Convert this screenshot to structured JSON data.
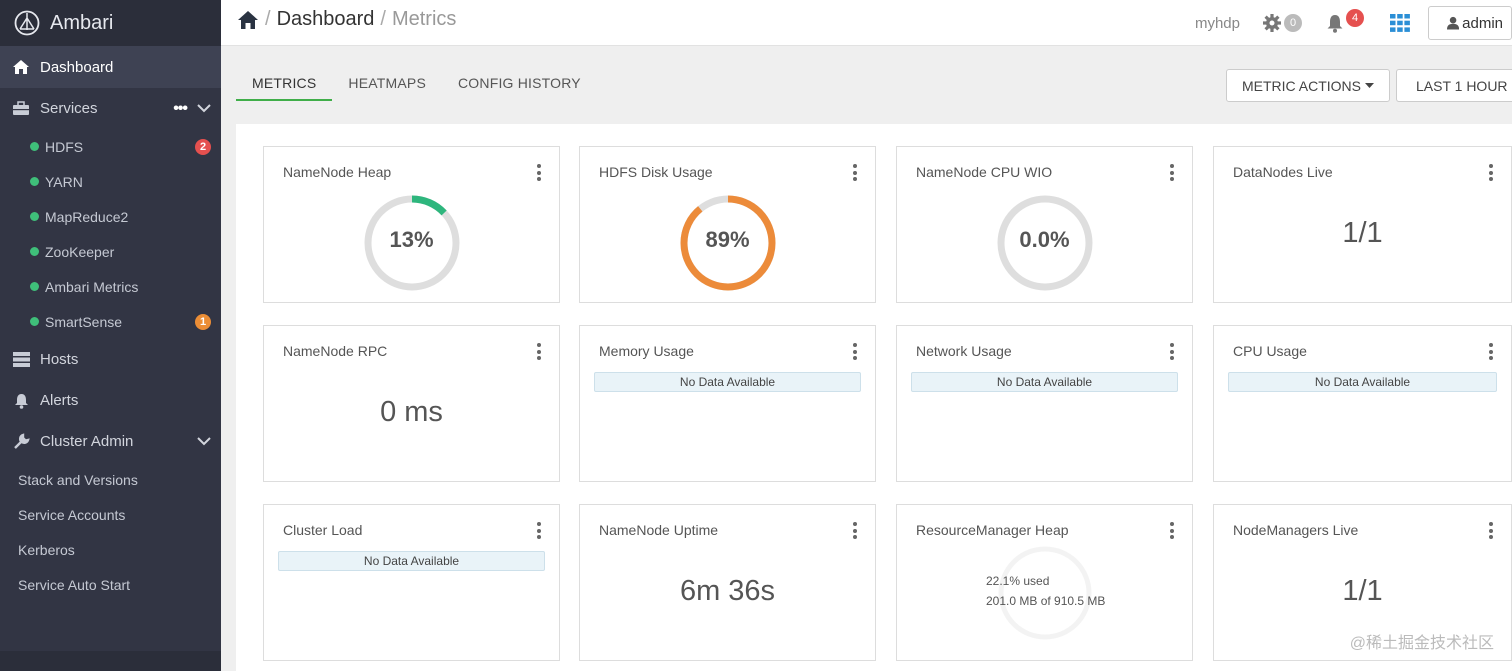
{
  "app": {
    "name": "Ambari"
  },
  "sidebar": {
    "dashboard": "Dashboard",
    "services": "Services",
    "service_items": [
      {
        "label": "HDFS",
        "badge": "2",
        "badge_color": "#e5504f"
      },
      {
        "label": "YARN"
      },
      {
        "label": "MapReduce2"
      },
      {
        "label": "ZooKeeper"
      },
      {
        "label": "Ambari Metrics"
      },
      {
        "label": "SmartSense",
        "badge": "1",
        "badge_color": "#eb8d36"
      }
    ],
    "hosts": "Hosts",
    "alerts": "Alerts",
    "cluster_admin": "Cluster Admin",
    "admin_items": [
      "Stack and Versions",
      "Service Accounts",
      "Kerberos",
      "Service Auto Start"
    ]
  },
  "header": {
    "breadcrumb_main": "Dashboard",
    "breadcrumb_sub": "Metrics",
    "cluster": "myhdp",
    "ops_count": "0",
    "alerts_count": "4",
    "user": "admin"
  },
  "tabs": [
    "METRICS",
    "HEATMAPS",
    "CONFIG HISTORY"
  ],
  "actions": {
    "metric_actions": "METRIC ACTIONS",
    "time_range": "LAST 1 HOUR"
  },
  "widgets": {
    "namenode_heap": {
      "title": "NameNode Heap",
      "value": "13%",
      "percent": 13,
      "color": "#2eb67d"
    },
    "hdfs_disk": {
      "title": "HDFS Disk Usage",
      "value": "89%",
      "percent": 89,
      "color": "#ec8b3a"
    },
    "namenode_cpu": {
      "title": "NameNode CPU WIO",
      "value": "0.0%",
      "percent": 0,
      "color": "#2eb67d"
    },
    "datanodes_live": {
      "title": "DataNodes Live",
      "value": "1/1"
    },
    "namenode_rpc": {
      "title": "NameNode RPC",
      "value": "0 ms"
    },
    "memory_usage": {
      "title": "Memory Usage",
      "nodata": "No Data Available"
    },
    "network_usage": {
      "title": "Network Usage",
      "nodata": "No Data Available"
    },
    "cpu_usage": {
      "title": "CPU Usage",
      "nodata": "No Data Available"
    },
    "cluster_load": {
      "title": "Cluster Load",
      "nodata": "No Data Available"
    },
    "namenode_uptime": {
      "title": "NameNode Uptime",
      "value": "6m 36s"
    },
    "rm_heap": {
      "title": "ResourceManager Heap",
      "used": "22.1% used",
      "detail": "201.0 MB of 910.5 MB"
    },
    "nodemanagers_live": {
      "title": "NodeManagers Live",
      "value": "1/1"
    }
  },
  "watermark": "@稀土掘金技术社区"
}
